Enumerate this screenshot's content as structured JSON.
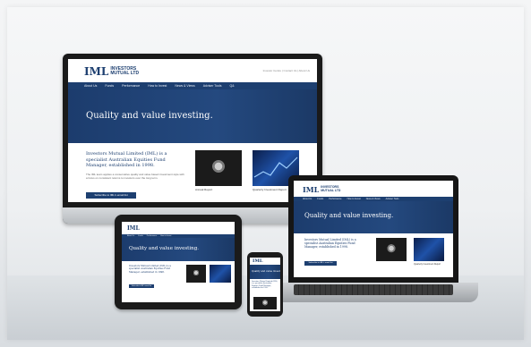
{
  "brand": {
    "mark": "IML",
    "name_line1": "INVESTORS",
    "name_line2": "MUTUAL LTD",
    "top_link": "Investor Centre | Contact Us | About Us",
    "primary_color": "#1d3f70"
  },
  "nav": {
    "items": [
      "About Us",
      "Funds",
      "Performance",
      "How to Invest",
      "News & Views",
      "Adviser Tools",
      "Q&"
    ]
  },
  "hero": {
    "title": "Quality and value investing."
  },
  "intro": {
    "heading": "Investors Mutual Limited (IML) is a specialist Australian Equities Fund Manager, established in 1998.",
    "body": "The IML team applies a conservative quality and value based investment style with a focus on consistent returns to investors over the long term.",
    "cta": "Subscribe to IML's email list"
  },
  "cards": [
    {
      "icon": "lion-image",
      "caption": "Annual Report"
    },
    {
      "icon": "chart-image",
      "caption": "Quarterly Investment Report"
    }
  ]
}
